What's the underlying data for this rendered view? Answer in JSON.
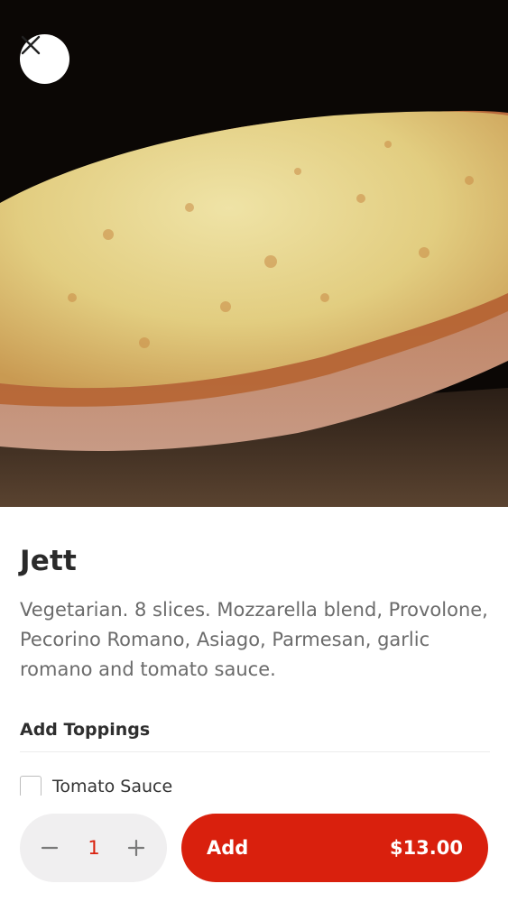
{
  "item": {
    "name": "Jett",
    "description": "Vegetarian. 8 slices. Mozzarella blend, Provolone, Pecorino Romano, Asiago, Parmesan, garlic romano and tomato sauce."
  },
  "hero": {
    "image": "pizza-photo"
  },
  "toppings": {
    "section_label": "Add Toppings",
    "items": [
      {
        "label": "Tomato Sauce",
        "checked": false
      }
    ]
  },
  "order": {
    "quantity": "1",
    "add_label": "Add",
    "price": "$13.00"
  },
  "icons": {
    "close": "close-icon",
    "minus": "minus-icon",
    "plus": "plus-icon"
  },
  "colors": {
    "accent": "#d9200d",
    "stepper_bg": "#f0eff0"
  }
}
